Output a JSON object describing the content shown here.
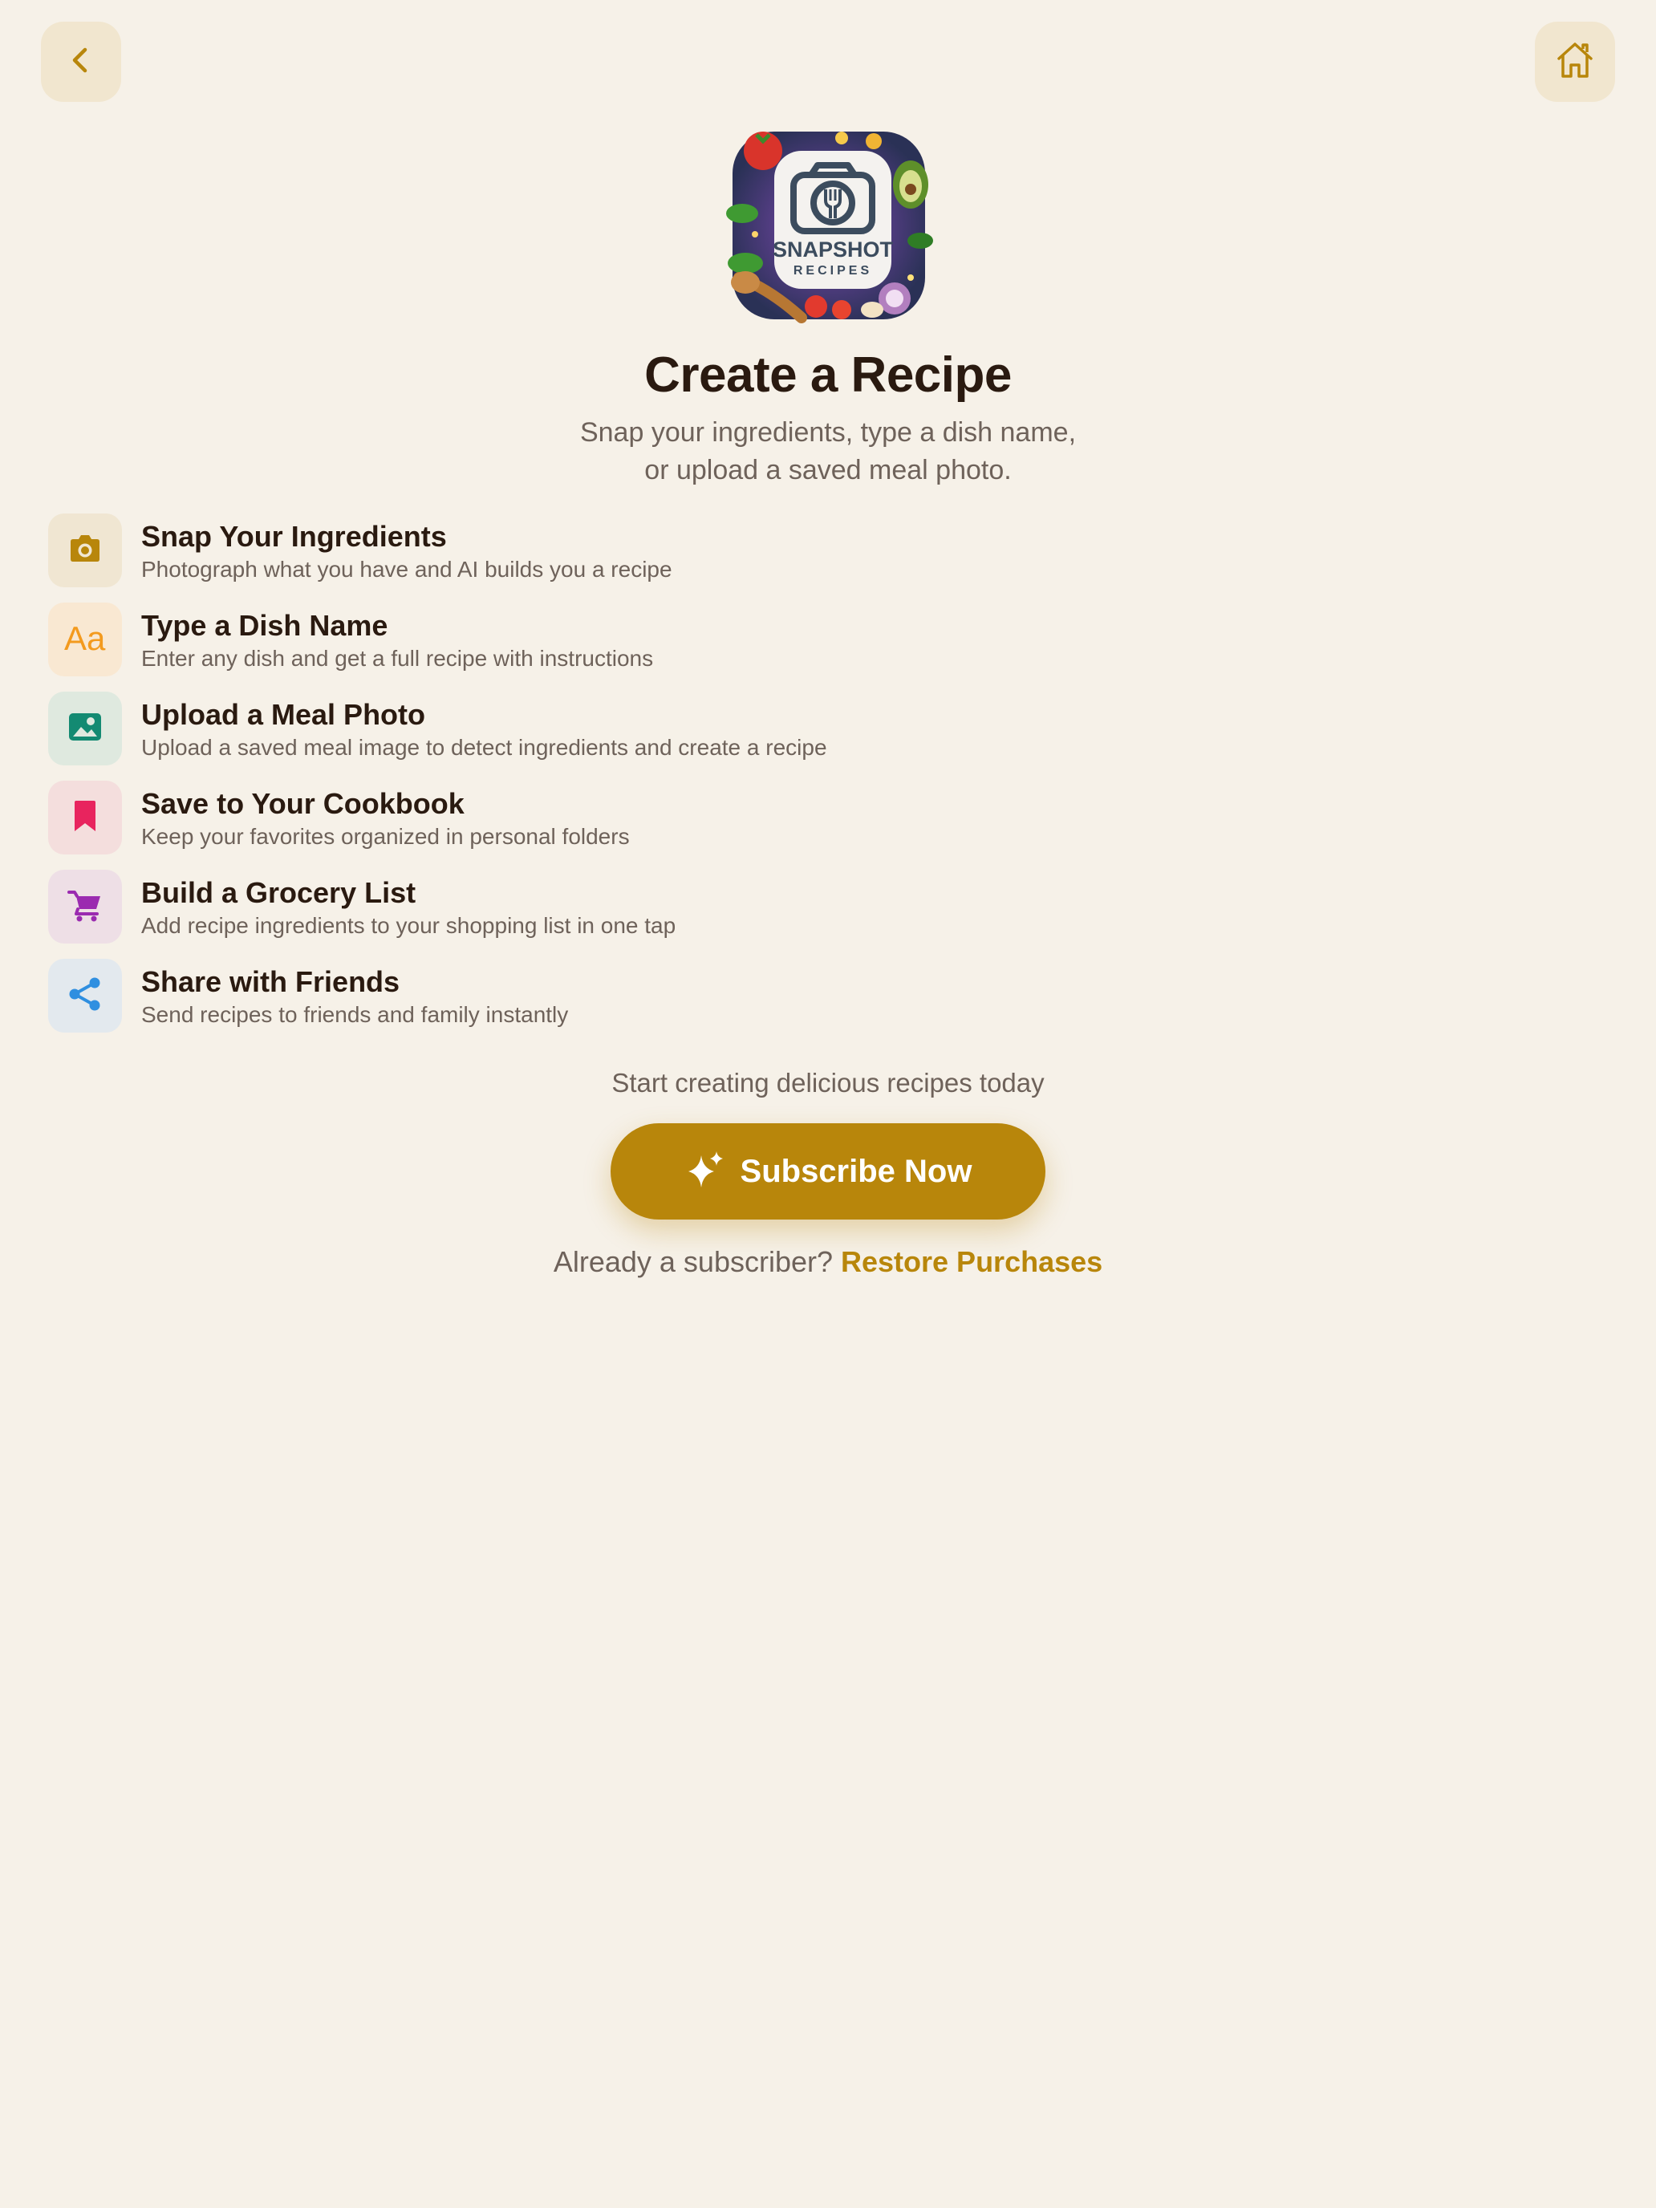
{
  "header": {
    "back_icon": "chevron-left-icon",
    "home_icon": "house-icon"
  },
  "logo": {
    "line1": "SNAPSHOT",
    "line2": "RECIPES"
  },
  "page": {
    "title": "Create a Recipe",
    "subtitle_line1": "Snap your ingredients, type a dish name,",
    "subtitle_line2": "or upload a saved meal photo."
  },
  "features": [
    {
      "title": "Snap Your Ingredients",
      "description": "Photograph what you have and AI builds you a recipe",
      "icon": "camera-icon",
      "color": "#b8860b",
      "bg": "#f0e6d2"
    },
    {
      "title": "Type a Dish Name",
      "description": "Enter any dish and get a full recipe with instructions",
      "icon": "text-aa-icon",
      "color": "#f39a1e",
      "bg": "#f9e8d2"
    },
    {
      "title": "Upload a Meal Photo",
      "description": "Upload a saved meal image to detect ingredients and create a recipe",
      "icon": "photo-icon",
      "color": "#138a72",
      "bg": "#dfe9df"
    },
    {
      "title": "Save to Your Cookbook",
      "description": "Keep your favorites organized in personal folders",
      "icon": "bookmark-icon",
      "color": "#e8245e",
      "bg": "#f4dedd"
    },
    {
      "title": "Build a Grocery List",
      "description": "Add recipe ingredients to your shopping list in one tap",
      "icon": "cart-icon",
      "color": "#9b2bb0",
      "bg": "#eedfe6"
    },
    {
      "title": "Share with Friends",
      "description": "Send recipes to friends and family instantly",
      "icon": "share-icon",
      "color": "#2f8fe0",
      "bg": "#e3e9ee"
    }
  ],
  "cta": {
    "tagline": "Start creating delicious recipes today",
    "subscribe_label": "Subscribe Now",
    "restore_prefix": "Already a subscriber? ",
    "restore_link": "Restore Purchases"
  },
  "colors": {
    "accent": "#b8860b",
    "background": "#f6f1e8",
    "text_dark": "#2a1a10",
    "text_muted": "#6e625a"
  }
}
